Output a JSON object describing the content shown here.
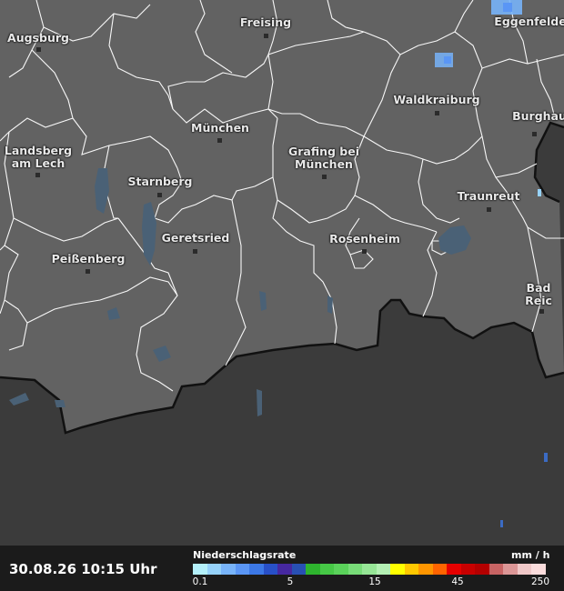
{
  "map": {
    "cities": [
      {
        "key": "augsburg",
        "name": "Augsburg"
      },
      {
        "key": "freising",
        "name": "Freising"
      },
      {
        "key": "eggenfelden",
        "name": "Eggenfelde"
      },
      {
        "key": "waldkraiburg",
        "name": "Waldkraiburg"
      },
      {
        "key": "burghausen",
        "name": "Burghau"
      },
      {
        "key": "muenchen",
        "name": "München"
      },
      {
        "key": "landsberg",
        "name": "Landsberg\nam Lech"
      },
      {
        "key": "grafing",
        "name": "Grafing bei\nMünchen"
      },
      {
        "key": "starnberg",
        "name": "Starnberg"
      },
      {
        "key": "traunreut",
        "name": "Traunreut"
      },
      {
        "key": "geretsried",
        "name": "Geretsried"
      },
      {
        "key": "rosenheim",
        "name": "Rosenheim"
      },
      {
        "key": "peissenberg",
        "name": "Peißenberg"
      },
      {
        "key": "bad-reichenhall",
        "name": "Bad Reic"
      }
    ]
  },
  "footer": {
    "timestamp": "30.08.26 10:15 Uhr",
    "legend": {
      "title": "Niederschlagsrate",
      "unit": "mm / h",
      "ticks": [
        "0.1",
        "5",
        "15",
        "45",
        "250"
      ],
      "colors": [
        "#b4f0fa",
        "#96d2fa",
        "#78b4fa",
        "#5a96f5",
        "#3c78e6",
        "#2850c8",
        "#4628a0",
        "#2850b4",
        "#2eb42e",
        "#46c846",
        "#5ad25a",
        "#78dc78",
        "#96e696",
        "#b4f0b4",
        "#ffff00",
        "#ffc800",
        "#ff9600",
        "#ff6400",
        "#e60000",
        "#c80000",
        "#b40000",
        "#c86464",
        "#dc9696",
        "#f0c8c8",
        "#fadcdc",
        "#dcc8f0",
        "#c8aadc",
        "#b48cc8"
      ]
    }
  }
}
